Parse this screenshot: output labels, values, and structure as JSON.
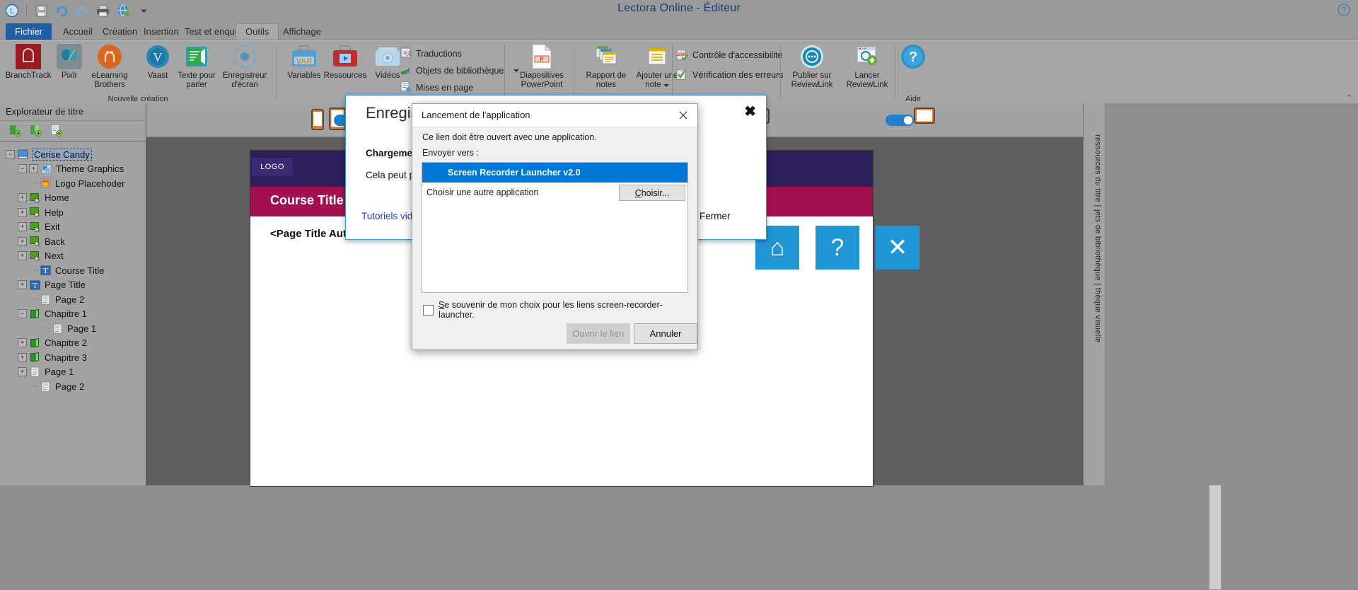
{
  "window": {
    "title": "Lectora Online - Éditeur",
    "help_icon": "question-help-icon"
  },
  "quick_access": {
    "items": [
      {
        "name": "lectora-logo-icon",
        "label": "L"
      },
      {
        "name": "save-icon",
        "label": "Enregistrer"
      },
      {
        "name": "undo-icon",
        "label": "Annuler"
      },
      {
        "name": "redo-icon",
        "label": "Rétablir"
      },
      {
        "name": "print-icon",
        "label": "Imprimer"
      },
      {
        "name": "preview-web-icon",
        "label": "Aperçu"
      },
      {
        "name": "chevron-down-icon",
        "label": "Plus"
      }
    ]
  },
  "tabs": [
    {
      "label": "Fichier",
      "state": "file"
    },
    {
      "label": "Accueil",
      "state": "normal"
    },
    {
      "label": "Création",
      "state": "normal"
    },
    {
      "label": "Insertion",
      "state": "normal"
    },
    {
      "label": "Test et enquête",
      "state": "normal"
    },
    {
      "label": "Outils",
      "state": "active"
    },
    {
      "label": "Affichage",
      "state": "normal"
    }
  ],
  "ribbon": {
    "groups": [
      {
        "label": "Nouvelle création"
      },
      {
        "label": ""
      },
      {
        "label": ""
      },
      {
        "label": ""
      },
      {
        "label": "Aide"
      }
    ],
    "new_creation": [
      {
        "label": "BranchTrack",
        "icon": "branchtrack-icon"
      },
      {
        "label": "Pixlr",
        "icon": "pixlr-butterfly-icon"
      },
      {
        "label": "eLearning Brothers",
        "icon": "elearning-brothers-icon"
      },
      {
        "label": "Vaast",
        "icon": "vaast-icon"
      },
      {
        "label": "Texte pour parler",
        "icon": "text-to-speech-icon"
      },
      {
        "label": "Enregistreur d'écran",
        "icon": "screen-recorder-icon"
      }
    ],
    "assets": [
      {
        "label": "Variables",
        "icon": "variables-briefcase-icon"
      },
      {
        "label": "Ressources",
        "icon": "resources-briefcase-icon"
      },
      {
        "label": "Vidéos",
        "icon": "videos-camera-icon"
      }
    ],
    "small_items": [
      {
        "label": "Traductions",
        "icon": "translations-icon",
        "dropdown": false
      },
      {
        "label": "Objets de bibliothèque",
        "icon": "library-objects-icon",
        "dropdown": true
      },
      {
        "label": "Mises en page",
        "icon": "page-layouts-icon",
        "dropdown": false
      }
    ],
    "publish": [
      {
        "label": "Diapositives PowerPoint",
        "icon": "powerpoint-icon"
      },
      {
        "label": "Rapport de notes",
        "icon": "notes-report-icon"
      },
      {
        "label": "Ajouter une note",
        "icon": "add-note-icon",
        "dropdown": true
      }
    ],
    "checks": [
      {
        "label": "Contrôle d'accessibilité",
        "icon": "accessibility-508-icon"
      },
      {
        "label": "Vérification des erreurs",
        "icon": "error-check-icon"
      }
    ],
    "reviewlink": [
      {
        "label": "Publier sur ReviewLink",
        "icon": "publish-reviewlink-icon"
      },
      {
        "label": "Lancer ReviewLink",
        "icon": "launch-reviewlink-icon"
      }
    ],
    "help": {
      "label": "Aide",
      "icon": "help-question-icon"
    }
  },
  "title_explorer": {
    "header": "Explorateur de titre",
    "toolbar": [
      {
        "name": "add-chapter-icon"
      },
      {
        "name": "add-section-icon"
      },
      {
        "name": "add-page-icon"
      }
    ],
    "tree": [
      {
        "label": "Cerise Candy",
        "indent": 0,
        "expander": "minus",
        "icon": "title-book-icon",
        "selected": true
      },
      {
        "label": "Theme Graphics",
        "indent": 1,
        "expander": "minus-plus",
        "icon": "theme-graphics-icon",
        "selected": false
      },
      {
        "label": "Logo Placehoder",
        "indent": 2,
        "expander": "none",
        "icon": "image-icon",
        "selected": false
      },
      {
        "label": "Home",
        "indent": 1,
        "expander": "plus",
        "icon": "button-icon",
        "selected": false
      },
      {
        "label": "Help",
        "indent": 1,
        "expander": "plus",
        "icon": "button-icon",
        "selected": false
      },
      {
        "label": "Exit",
        "indent": 1,
        "expander": "plus",
        "icon": "button-icon",
        "selected": false
      },
      {
        "label": "Back",
        "indent": 1,
        "expander": "plus",
        "icon": "button-icon",
        "selected": false
      },
      {
        "label": "Next",
        "indent": 1,
        "expander": "plus",
        "icon": "button-icon",
        "selected": false
      },
      {
        "label": "Course Title",
        "indent": 2,
        "expander": "none",
        "icon": "text-icon",
        "selected": false
      },
      {
        "label": "Page Title",
        "indent": 1,
        "expander": "plus",
        "icon": "text-icon",
        "selected": false
      },
      {
        "label": "Page 2",
        "indent": 2,
        "expander": "none",
        "icon": "page-icon",
        "selected": false
      },
      {
        "label": "Chapitre 1",
        "indent": 1,
        "expander": "minus",
        "icon": "chapter-icon",
        "selected": false
      },
      {
        "label": "Page 1",
        "indent": 3,
        "expander": "none",
        "icon": "page-icon",
        "selected": false
      },
      {
        "label": "Chapitre 2",
        "indent": 1,
        "expander": "plus",
        "icon": "chapter-icon",
        "selected": false
      },
      {
        "label": "Chapitre 3",
        "indent": 1,
        "expander": "plus",
        "icon": "chapter-icon",
        "selected": false
      },
      {
        "label": "Page 1",
        "indent": 1,
        "expander": "plus",
        "icon": "page-icon",
        "selected": false
      },
      {
        "label": "Page 2",
        "indent": 2,
        "expander": "none",
        "icon": "page-icon",
        "selected": false
      }
    ]
  },
  "canvas": {
    "page": {
      "logo": "LOGO",
      "course_title": "Course Title",
      "page_title": "<Page Title Auto",
      "nav_buttons": [
        {
          "name": "home-nav-button",
          "glyph": "⌂"
        },
        {
          "name": "help-nav-button",
          "glyph": "?"
        },
        {
          "name": "close-nav-button",
          "glyph": "✕"
        }
      ]
    },
    "right_rail_text": "ressources du titre | jets de bibliothèque | thèque visuelle"
  },
  "outer_dialog": {
    "title": "Enregistre",
    "close": "✖",
    "bold_text": "Chargement",
    "body_text": "Cela peut pr",
    "link_text": "Tutoriels vid",
    "button_label": "Fermer"
  },
  "inner_dialog": {
    "title": "Lancement de l'application",
    "close_icon": "close-icon",
    "message": "Ce lien doit être ouvert avec une application.",
    "sub_label": "Envoyer vers :",
    "options": [
      {
        "label": "Screen Recorder Launcher v2.0",
        "selected": true,
        "has_button": false
      },
      {
        "label": "Choisir une autre application",
        "selected": false,
        "has_button": true,
        "button_label": "Choisir..."
      }
    ],
    "checkbox": {
      "checked": false,
      "label_prefix": "S",
      "label_rest": "e souvenir de mon choix pour les liens screen-recorder-launcher."
    },
    "buttons": [
      {
        "label": "Ouvrir le lien",
        "state": "disabled"
      },
      {
        "label": "Annuler",
        "state": "enabled"
      }
    ]
  },
  "colors": {
    "accent_blue": "#0078d7",
    "title_blue": "#123f73",
    "dialog_border": "#2f9fdc",
    "page_band": "#a31050",
    "page_top": "#2c1f5b",
    "nav_blue": "#2196d4"
  }
}
